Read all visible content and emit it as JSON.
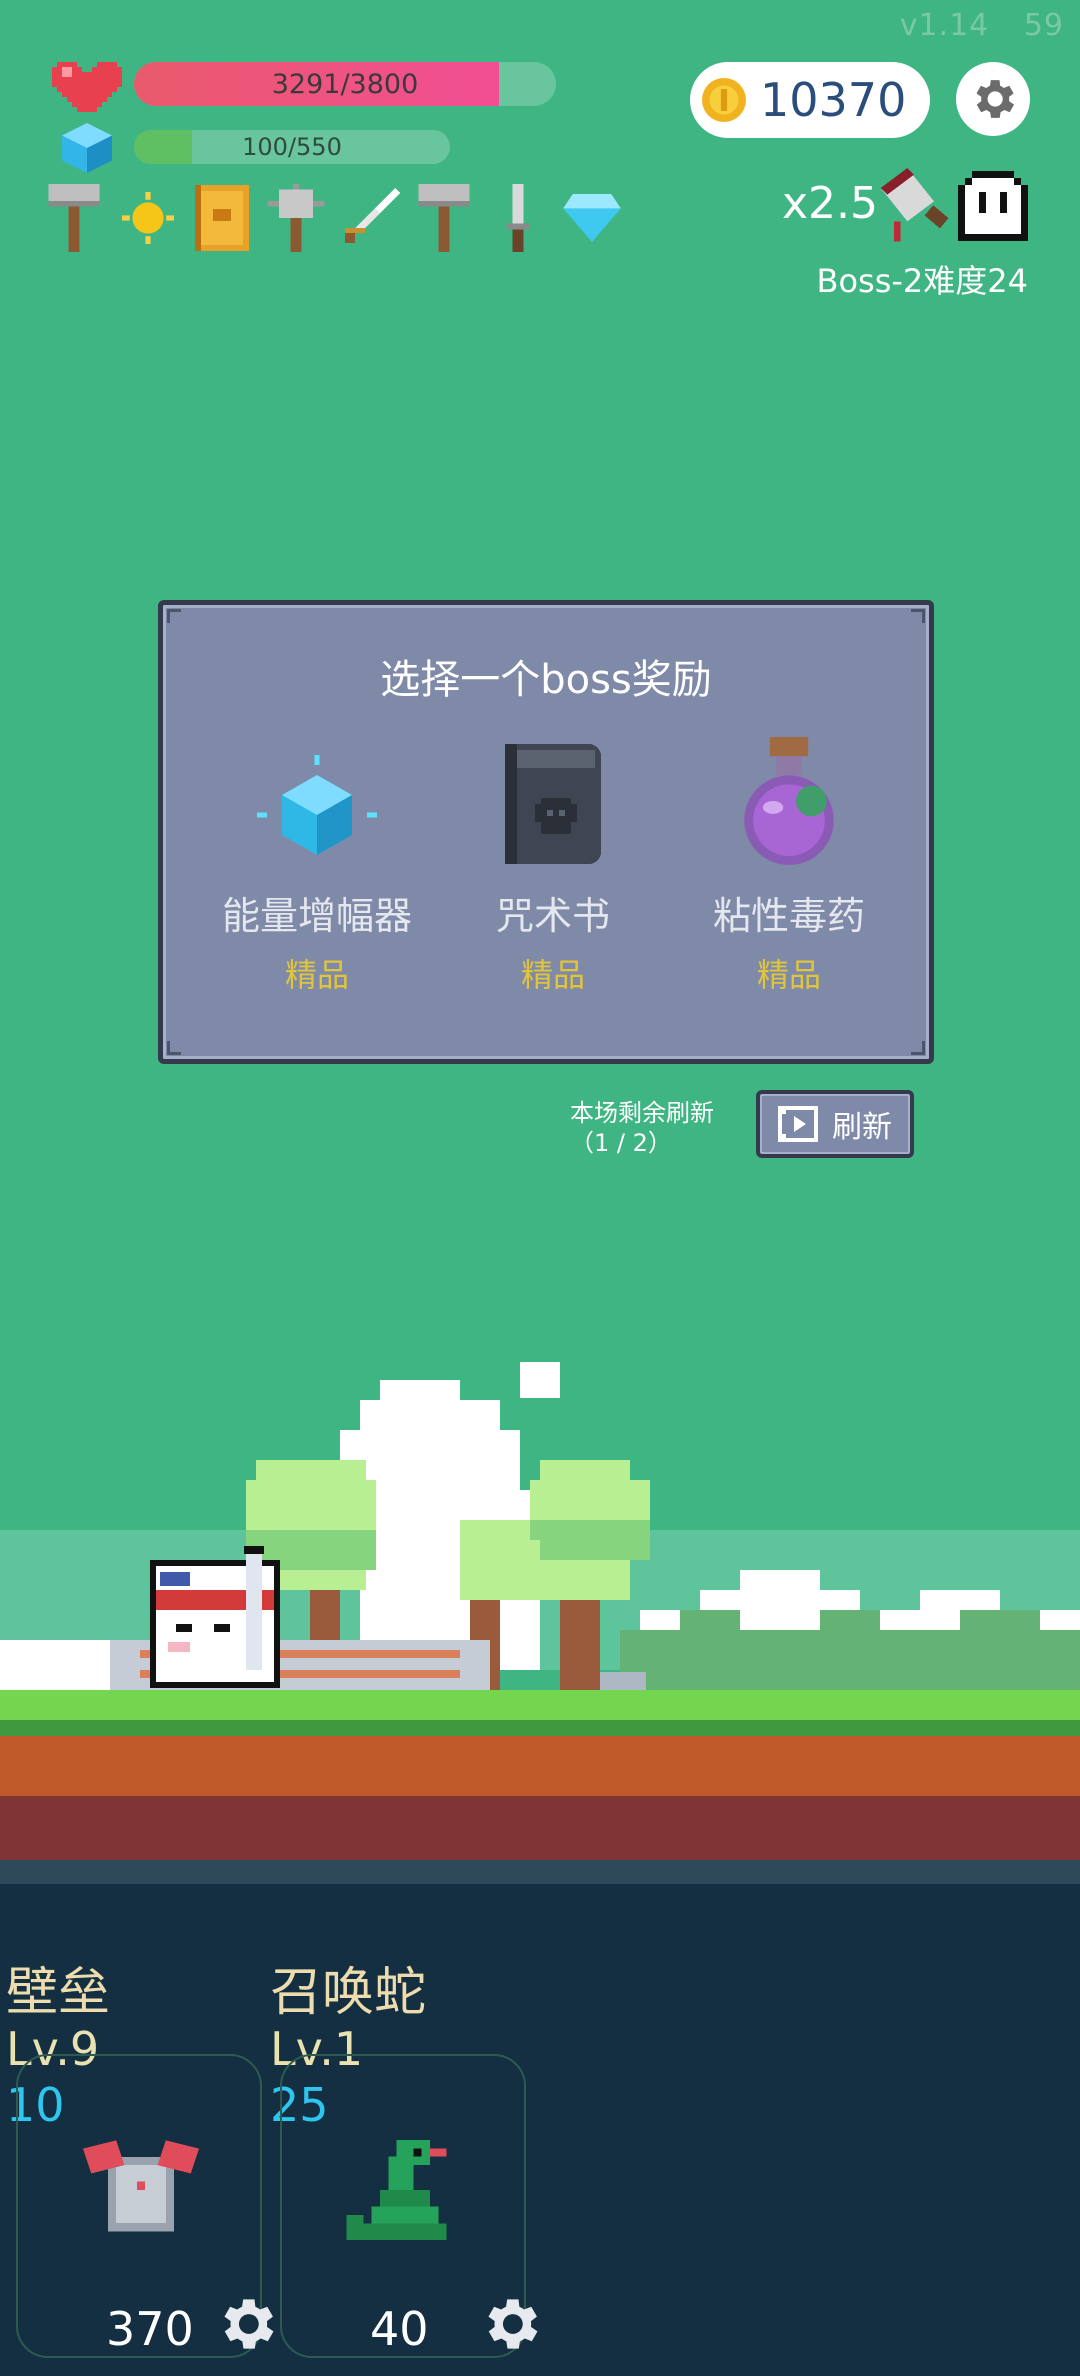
{
  "app": {
    "version": "v1.14",
    "fps": "59"
  },
  "stats": {
    "hp_text": "3291/3800",
    "hp_fraction": 0.866,
    "mp_text": "100/550",
    "mp_fraction": 0.182,
    "coins": "10370"
  },
  "items": [
    {
      "icon": "hammer-icon"
    },
    {
      "icon": "sun-amulet-icon"
    },
    {
      "icon": "crown-book-icon"
    },
    {
      "icon": "spiked-mace-icon"
    },
    {
      "icon": "sword-icon"
    },
    {
      "icon": "hammer-icon"
    },
    {
      "icon": "dagger-icon"
    },
    {
      "icon": "diamond-icon"
    }
  ],
  "game": {
    "speed": "x2.5",
    "boss_difficulty": "Boss-2难度24"
  },
  "reward_panel": {
    "title": "选择一个boss奖励",
    "options": [
      {
        "name": "能量增幅器",
        "rarity": "精品",
        "icon": "energy-crystal-icon"
      },
      {
        "name": "咒术书",
        "rarity": "精品",
        "icon": "skull-book-icon"
      },
      {
        "name": "粘性毒药",
        "rarity": "精品",
        "icon": "poison-potion-icon"
      }
    ],
    "refresh_remaining": "本场剩余刷新\n（1 / 2）",
    "refresh_label": "刷新"
  },
  "skills": [
    {
      "name": "壁垒",
      "level": "Lv.9",
      "power": "10",
      "cost": "370",
      "icon": "armor-icon"
    },
    {
      "name": "召唤蛇",
      "level": "Lv.1",
      "power": "25",
      "cost": "40",
      "icon": "snake-icon"
    }
  ],
  "colors": {
    "background": "#3fb583",
    "hp_fill": "#ea5a6c",
    "hp_fill_end": "#f24e94",
    "mp_fill": "#5ebf63",
    "rarity": "#e0c53c",
    "panel": "#7f8aa8",
    "bottom_panel": "#142f41"
  }
}
